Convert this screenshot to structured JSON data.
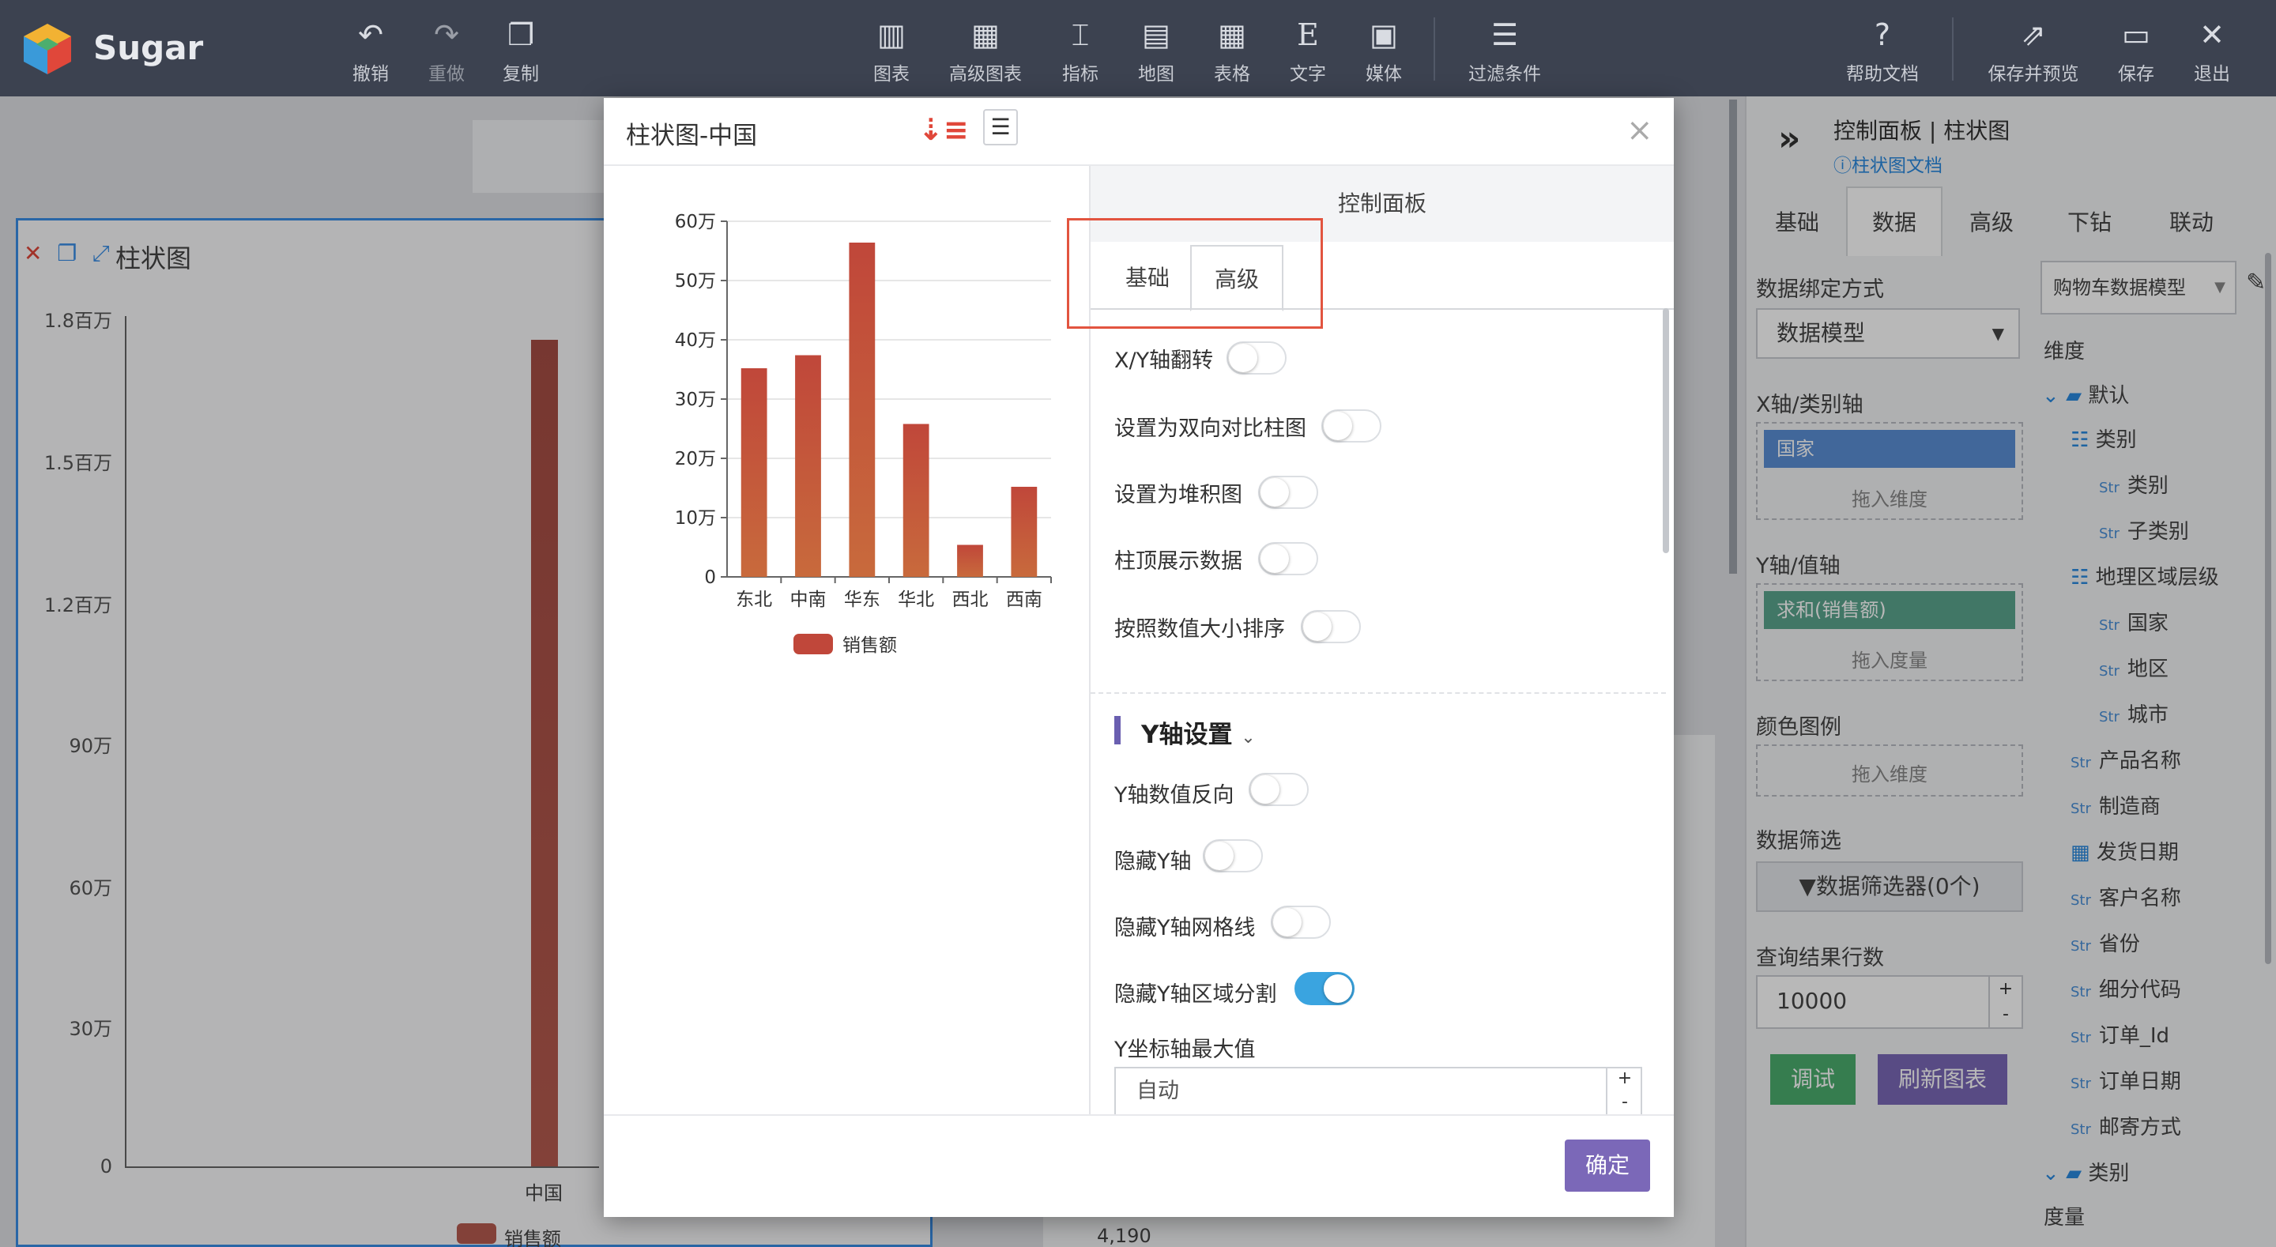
{
  "app": {
    "brand": "Sugar"
  },
  "toolbar": {
    "undo": "撤销",
    "redo": "重做",
    "copy": "复制",
    "chart": "图表",
    "advanced_chart": "高级图表",
    "metric": "指标",
    "map": "地图",
    "table": "表格",
    "text": "文字",
    "media": "媒体",
    "filter": "过滤条件",
    "help": "帮助文档",
    "save_preview": "保存并预览",
    "save": "保存",
    "exit": "退出"
  },
  "background": {
    "panel_title": "柱状图",
    "y_ticks": [
      "1.8百万",
      "1.5百万",
      "1.2百万",
      "90万",
      "60万",
      "30万",
      "0"
    ],
    "x_label": "中国",
    "legend": "销售额",
    "extra_value": "4,190"
  },
  "right_panel": {
    "title": "控制面板 | 柱状图",
    "doc_link": "柱状图文档",
    "tabs": [
      "基础",
      "数据",
      "高级",
      "下钻",
      "联动"
    ],
    "binding_label": "数据绑定方式",
    "binding_value": "数据模型",
    "model_value": "购物车数据模型",
    "x_axis_label": "X轴/类别轴",
    "x_field": "国家",
    "drop_dimension": "拖入维度",
    "y_axis_label": "Y轴/值轴",
    "y_field": "求和(销售额)",
    "drop_measure": "拖入度量",
    "color_legend_label": "颜色图例",
    "filter_label": "数据筛选",
    "filter_button": "数据筛选器(0个)",
    "rows_label": "查询结果行数",
    "rows_value": "10000",
    "debug_button": "调试",
    "refresh_button": "刷新图表",
    "dimension_title": "维度",
    "measure_title": "度量",
    "tree": {
      "default_folder": "默认",
      "category_group": "类别",
      "category": "类别",
      "subcategory": "子类别",
      "geo_group": "地理区域层级",
      "country": "国家",
      "region": "地区",
      "city": "城市",
      "product_name": "产品名称",
      "maker": "制造商",
      "ship_date": "发货日期",
      "customer": "客户名称",
      "province": "省份",
      "segment_code": "细分代码",
      "order_id": "订单_Id",
      "order_date": "订单日期",
      "ship_mode": "邮寄方式",
      "category_folder": "类别",
      "str_tag": "Str"
    }
  },
  "modal": {
    "title": "柱状图-中国",
    "control_panel_header": "控制面板",
    "tabs": [
      "基础",
      "高级"
    ],
    "options": {
      "flip_xy": "X/Y轴翻转",
      "bidirectional": "设置为双向对比柱图",
      "stacked": "设置为堆积图",
      "show_top_data": "柱顶展示数据",
      "sort_by_value": "按照数值大小排序"
    },
    "y_section_title": "Y轴设置",
    "y_options": {
      "reverse": "Y轴数值反向",
      "hide_axis": "隐藏Y轴",
      "hide_grid": "隐藏Y轴网格线",
      "hide_split_area": "隐藏Y轴区域分割"
    },
    "toggle_states": {
      "flip_xy": false,
      "bidirectional": false,
      "stacked": false,
      "show_top_data": false,
      "sort_by_value": false,
      "reverse": false,
      "hide_axis": false,
      "hide_grid": false,
      "hide_split_area": true
    },
    "y_max_label": "Y坐标轴最大值",
    "y_max_value": "自动",
    "confirm": "确定"
  },
  "chart_data": {
    "type": "bar",
    "categories": [
      "东北",
      "中南",
      "华东",
      "华北",
      "西北",
      "西南"
    ],
    "series": [
      {
        "name": "销售额",
        "values": [
          352000,
          374000,
          564000,
          258000,
          54000,
          152000
        ]
      }
    ],
    "y_ticks": [
      "0",
      "10万",
      "20万",
      "30万",
      "40万",
      "50万",
      "60万"
    ],
    "ylim": [
      0,
      600000
    ],
    "grid": true,
    "legend": "bottom",
    "bar_color": "#c0473a"
  },
  "colors": {
    "accent": "#7b68b8",
    "toggle_on": "#3aa4e0",
    "highlight": "#e2543f",
    "topbar": "#3c4250"
  }
}
